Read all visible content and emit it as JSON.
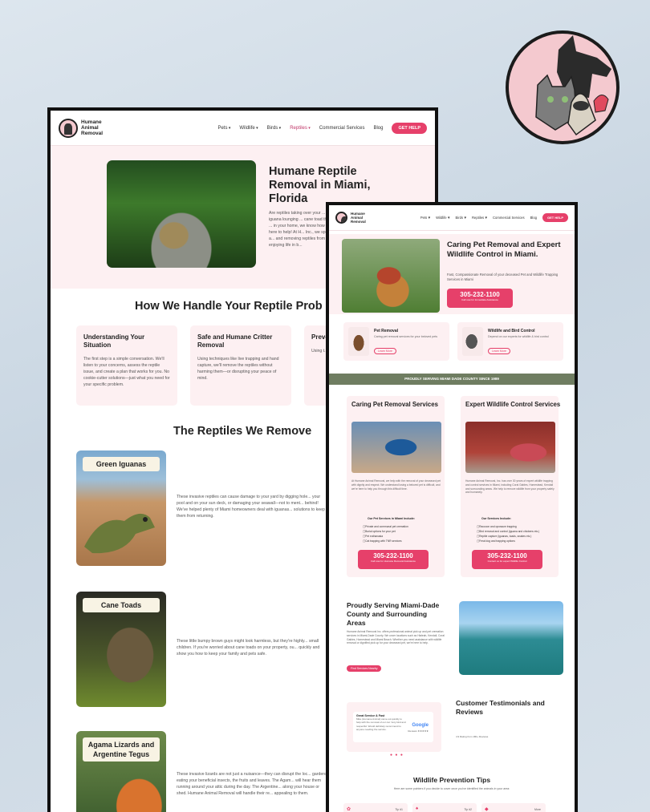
{
  "back": {
    "brand": "Humane Animal Removal",
    "menu": [
      "Pets",
      "Wildlife",
      "Birds",
      "Reptiles",
      "Commercial Services",
      "Blog"
    ],
    "cta": "GET HELP",
    "hero_title": "Humane Reptile Removal in Miami, Florida",
    "hero_body": "Are reptiles taking over your ... an invasive iguana lounging ... cane toad threatening your ... in your home, we know how ... why we're here to help! At H... Inc., we specialize in safely a... and removing reptiles from y... get back to enjoying life in b...",
    "handle_title": "How We Handle Your Reptile Prob",
    "cards": [
      {
        "title": "Understanding Your Situation",
        "body": "The first step is a simple conversation. We'll listen to your concerns, assess the reptile issue, and create a plan that works for you. No cookie-cutter solutions—just what you need for your specific problem."
      },
      {
        "title": "Safe and Humane Critter Removal",
        "body": "Using techniques like live trapping and hand capture, we'll remove the reptiles without harming them—or disrupting your peace of mind."
      },
      {
        "title": "Preve On",
        "body": "Using t... habitat... birds a... —alway..."
      }
    ],
    "reptiles_title": "The Reptiles We Remove",
    "reptiles": [
      {
        "name": "Green Iguanas",
        "desc": "These invasive reptiles can cause damage to your yard by digging hole... your pool and on your sun deck, or damaging your seawall—not to ment... behind! We've helped plenty of Miami homeowners deal with iguanas... solutions to keep them from returning."
      },
      {
        "name": "Cane Toads",
        "desc": "These little bumpy brown guys might look harmless, but they're highly... small children. If you're worried about cane toads on your property, ou... quickly and show you how to keep your family and pets safe."
      },
      {
        "name": "Agama Lizards and Argentine Tegus",
        "desc": "These invasive lizards are not just a nuisance—they can disrupt the loc... gardens eating your beneficial insects, the fruits and leaves. The Agam... will hear them running around your attic during the day. The Argentine... along your house or shed. Humane Animal Removal will handle their re... appealing to them."
      }
    ]
  },
  "front": {
    "brand": "Humane Animal Removal",
    "menu": [
      "Pets",
      "Wildlife",
      "Birds",
      "Reptiles",
      "Commercial Services",
      "Blog"
    ],
    "cta": "GET HELP",
    "hero_title": "Caring Pet Removal and Expert Wildlife Control in Miami.",
    "hero_sub": "Fast, Compassionate Removal of your deceased Pet and Wildlife Trapping Services in Miami",
    "phone": "305-232-1100",
    "phone_sub": "Call now for Immediate Assistance",
    "svc_cards": [
      {
        "title": "Pet Removal",
        "body": "Caring pet removal services for your beloved pets",
        "link": "Learn More"
      },
      {
        "title": "Wildlife and Bird Control",
        "body": "Depend on our experts for wildlife & bird control",
        "link": "Learn More"
      }
    ],
    "banner": "PROUDLY SERVING MIAMI DADE COUNTY SINCE 1989",
    "sections": [
      {
        "title": "Caring Pet Removal Services",
        "body": "At Humane Animal Removal, we help with the removal of your deceased pet with dignity and respect. We understand losing a beloved pet is difficult, and we're here to help you through this difficult time.",
        "list_title": "Our Pet Services in Miami Include:",
        "items": [
          "Private and communal pet cremation",
          "Burial options for your pet",
          "Pet euthanasia",
          "Cat trapping with TNR services"
        ],
        "phone_sub": "Call now for Humane Removal Assistance"
      },
      {
        "title": "Expert Wildlife Control Services",
        "body": "Humane Animal Removal, Inc. has over 30 years of expert wildlife trapping and control services in Miami, including Coral Gables, Homestead, Kendall and surrounding areas. We help to remove wildlife from your property safely and humanely.",
        "list_title": "Our Services Include:",
        "items": [
          "Raccoon and opossum trapping",
          "Bird removal and control (iguana and chickens etc.)",
          "Reptile capture (iguanas, toads, snakes etc.)",
          "Feral dog and trapping options"
        ],
        "phone_sub": "Contact us for expert Wildlife Control"
      }
    ],
    "area_title": "Proudly Serving Miami-Dade County and Surrounding Areas",
    "area_body": "Humane Animal Removal Inc. offers professional animal pick up and pet cremation services in Miami-Dade County. We cover locations such as Hialeah, Kendall, Coral Gables, Homestead and Miami Beach. Whether you need assistance with wildlife removal or dignified pick up for your deceased pet, we're here to help.",
    "area_btn": "Find Services Nearby",
    "testi_title": "Customer Testimonials and Reviews",
    "testi_head": "Great Service & Fast",
    "testi_body": "Mike (Humane Animal) came out quickly to help with the removal of our cat. Very kind and respectful. Would definitely recommend to anyone needing the service.",
    "google": "Google",
    "google_sub": "Reviews ★★★★★",
    "testi_rating": "4.9 Rating from 180+ Reviews",
    "tips_title": "Wildlife Prevention Tips",
    "tips_sub": "Here are some pointers if you decide to cover once you've identified the animals in your area:",
    "tips": [
      "Tip #1",
      "Tip #2",
      "Tip #3",
      "More"
    ]
  }
}
